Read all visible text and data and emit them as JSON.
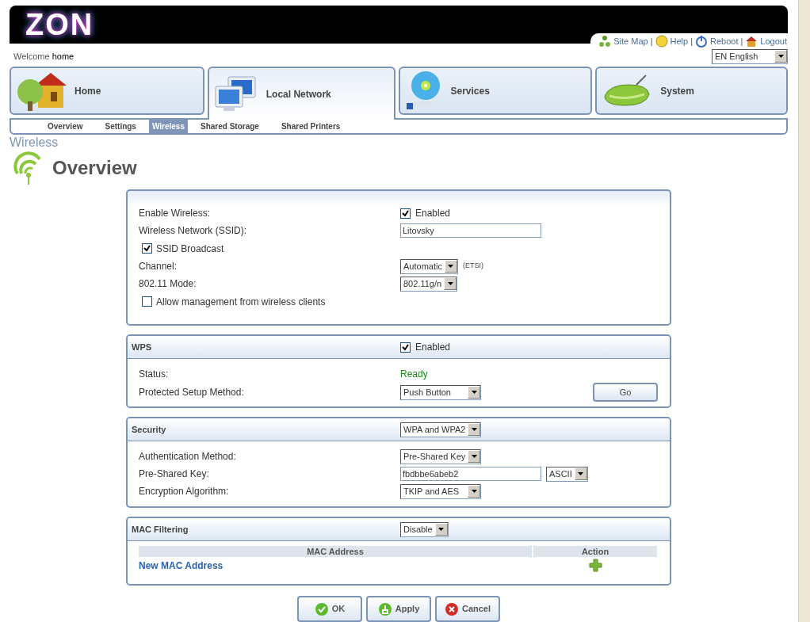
{
  "header": {
    "logo": "ZON",
    "separator": "|",
    "links": [
      {
        "label": "Site Map"
      },
      {
        "label": "Help"
      },
      {
        "label": "Reboot"
      },
      {
        "label": "Logout"
      }
    ]
  },
  "welcome": {
    "prefix": "Welcome",
    "user": "home"
  },
  "language": "EN English",
  "main_tabs": [
    {
      "label": "Home",
      "selected": false
    },
    {
      "label": "Local Network",
      "selected": true
    },
    {
      "label": "Services",
      "selected": false
    },
    {
      "label": "System",
      "selected": false
    }
  ],
  "sub_tabs": [
    {
      "label": "Overview",
      "selected": false
    },
    {
      "label": "Settings",
      "selected": false
    },
    {
      "label": "Wireless",
      "selected": true
    },
    {
      "label": "Shared Storage",
      "selected": false
    },
    {
      "label": "Shared Printers",
      "selected": false
    }
  ],
  "breadcrumb": "Wireless",
  "page_title": "Overview",
  "sections": [
    {
      "rows": [
        {
          "kind": "check",
          "label": "Enable Wireless:",
          "check_label": "Enabled",
          "checked": true
        },
        {
          "kind": "text",
          "label": "Wireless Network (SSID):",
          "value": "Litovsky"
        },
        {
          "kind": "checkbox",
          "label": "SSID Broadcast",
          "checked": true
        },
        {
          "kind": "select",
          "label": "Channel:",
          "value": "Automatic",
          "note": "(ETSI)"
        },
        {
          "kind": "select",
          "label": "802.11 Mode:",
          "value": "802.11g/n"
        },
        {
          "kind": "checkbox",
          "label": "Allow management from wireless clients",
          "checked": false
        }
      ]
    },
    {
      "title": "WPS",
      "control": {
        "kind": "check",
        "check_label": "Enabled",
        "checked": true
      },
      "rows": [
        {
          "kind": "status",
          "label": "Status:",
          "value": "Ready"
        },
        {
          "kind": "select",
          "label": "Protected Setup Method:",
          "value": "Push Button",
          "button": "Go"
        }
      ]
    },
    {
      "title": "Security",
      "control": {
        "kind": "select",
        "value": "WPA and WPA2"
      },
      "rows": [
        {
          "kind": "select",
          "label": "Authentication Method:",
          "value": "Pre-Shared Key"
        },
        {
          "kind": "text",
          "label": "Pre-Shared Key:",
          "value": "fbdbbe6abeb2",
          "select": "ASCII"
        },
        {
          "kind": "select",
          "label": "Encryption Algorithm:",
          "value": "TKIP and AES"
        }
      ]
    },
    {
      "title": "MAC Filtering",
      "control": {
        "kind": "select",
        "value": "Disable"
      },
      "table": {
        "columns": [
          "MAC Address",
          "Action"
        ],
        "link": "New MAC Address"
      }
    }
  ],
  "buttons": [
    {
      "label": "OK"
    },
    {
      "label": "Apply"
    },
    {
      "label": "Cancel"
    }
  ]
}
